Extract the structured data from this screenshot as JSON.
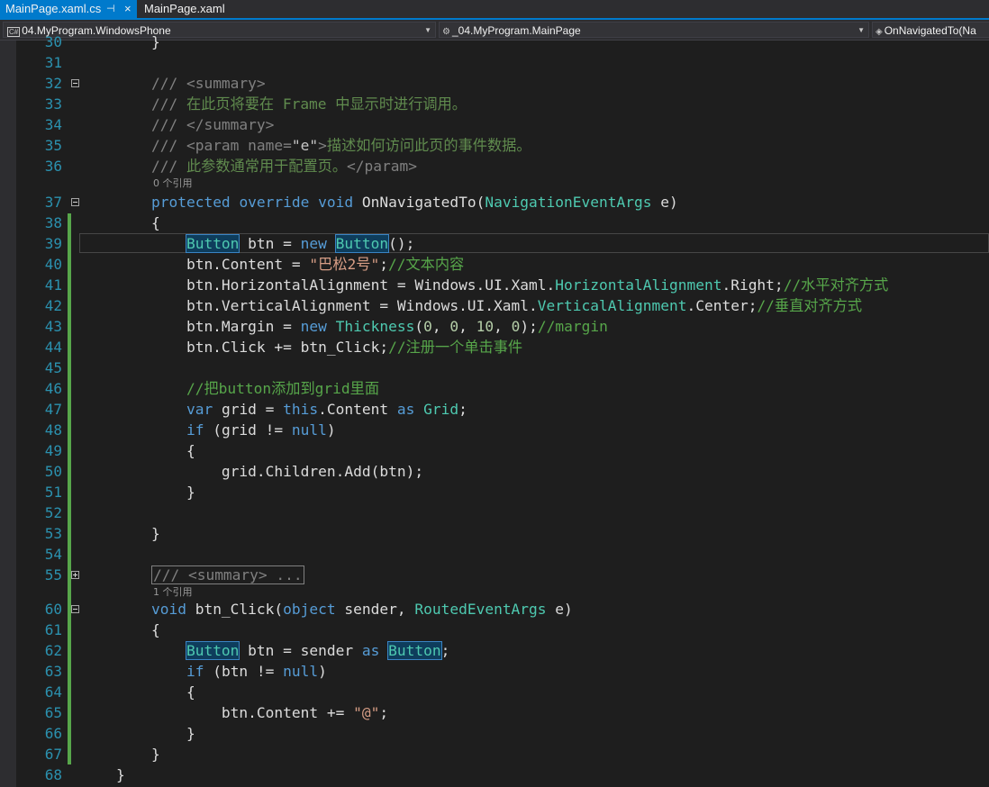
{
  "tabs": [
    {
      "label": "MainPage.xaml.cs",
      "active": true,
      "pin_glyph": "⊣",
      "close_glyph": "×"
    },
    {
      "label": "MainPage.xaml",
      "active": false
    }
  ],
  "navbar": {
    "project": "04.MyProgram.WindowsPhone",
    "class": "_04.MyProgram.MainPage",
    "member": "OnNavigatedTo(Na"
  },
  "codelens": {
    "ref0": "0 个引用",
    "ref1": "1 个引用"
  },
  "lines": [
    {
      "n": "30",
      "fold": "",
      "hl": false,
      "tokens": [
        {
          "t": "        }",
          "c": ""
        }
      ]
    },
    {
      "n": "31",
      "fold": "",
      "hl": false,
      "tokens": []
    },
    {
      "n": "32",
      "fold": "minus",
      "hl": false,
      "tokens": [
        {
          "t": "        ",
          "c": ""
        },
        {
          "t": "/// ",
          "c": "dtag"
        },
        {
          "t": "<summary>",
          "c": "dtag"
        }
      ]
    },
    {
      "n": "33",
      "fold": "",
      "hl": false,
      "tokens": [
        {
          "t": "        ",
          "c": ""
        },
        {
          "t": "/// ",
          "c": "dtag"
        },
        {
          "t": "在此页将要在 Frame 中显示时进行调用。",
          "c": "dc"
        }
      ]
    },
    {
      "n": "34",
      "fold": "",
      "hl": false,
      "tokens": [
        {
          "t": "        ",
          "c": ""
        },
        {
          "t": "/// ",
          "c": "dtag"
        },
        {
          "t": "</summary>",
          "c": "dtag"
        }
      ]
    },
    {
      "n": "35",
      "fold": "",
      "hl": false,
      "tokens": [
        {
          "t": "        ",
          "c": ""
        },
        {
          "t": "/// ",
          "c": "dtag"
        },
        {
          "t": "<param name=",
          "c": "dtag"
        },
        {
          "t": "\"e\"",
          "c": "dq"
        },
        {
          "t": ">",
          "c": "dtag"
        },
        {
          "t": "描述如何访问此页的事件数据。",
          "c": "dc"
        }
      ]
    },
    {
      "n": "36",
      "fold": "",
      "hl": false,
      "tokens": [
        {
          "t": "        ",
          "c": ""
        },
        {
          "t": "/// ",
          "c": "dtag"
        },
        {
          "t": "此参数通常用于配置页。",
          "c": "dc"
        },
        {
          "t": "</param>",
          "c": "dtag"
        }
      ]
    },
    {
      "n": "37",
      "fold": "minus",
      "hl": false,
      "tokens": [
        {
          "t": "        ",
          "c": ""
        },
        {
          "t": "protected",
          "c": "kw"
        },
        {
          "t": " ",
          "c": ""
        },
        {
          "t": "override",
          "c": "kw"
        },
        {
          "t": " ",
          "c": ""
        },
        {
          "t": "void",
          "c": "kw"
        },
        {
          "t": " OnNavigatedTo(",
          "c": ""
        },
        {
          "t": "NavigationEventArgs",
          "c": "ty"
        },
        {
          "t": " e)",
          "c": ""
        }
      ]
    },
    {
      "n": "38",
      "fold": "",
      "hl": false,
      "tokens": [
        {
          "t": "        {",
          "c": ""
        }
      ]
    },
    {
      "n": "39",
      "fold": "",
      "hl": true,
      "tokens": [
        {
          "t": "            ",
          "c": ""
        },
        {
          "t": "Button",
          "c": "ty refhl"
        },
        {
          "t": " btn = ",
          "c": ""
        },
        {
          "t": "new",
          "c": "kw"
        },
        {
          "t": " ",
          "c": ""
        },
        {
          "t": "Button",
          "c": "ty refhl"
        },
        {
          "t": "();",
          "c": ""
        }
      ]
    },
    {
      "n": "40",
      "fold": "",
      "hl": false,
      "tokens": [
        {
          "t": "            btn.Content = ",
          "c": ""
        },
        {
          "t": "\"巴松2号\"",
          "c": "st"
        },
        {
          "t": ";",
          "c": ""
        },
        {
          "t": "//文本内容",
          "c": "cm"
        }
      ]
    },
    {
      "n": "41",
      "fold": "",
      "hl": false,
      "tokens": [
        {
          "t": "            btn.HorizontalAlignment = Windows.UI.Xaml.",
          "c": ""
        },
        {
          "t": "HorizontalAlignment",
          "c": "ty"
        },
        {
          "t": ".Right;",
          "c": ""
        },
        {
          "t": "//水平对齐方式",
          "c": "cm"
        }
      ]
    },
    {
      "n": "42",
      "fold": "",
      "hl": false,
      "tokens": [
        {
          "t": "            btn.VerticalAlignment = Windows.UI.Xaml.",
          "c": ""
        },
        {
          "t": "VerticalAlignment",
          "c": "ty"
        },
        {
          "t": ".Center;",
          "c": ""
        },
        {
          "t": "//垂直对齐方式",
          "c": "cm"
        }
      ]
    },
    {
      "n": "43",
      "fold": "",
      "hl": false,
      "tokens": [
        {
          "t": "            btn.Margin = ",
          "c": ""
        },
        {
          "t": "new",
          "c": "kw"
        },
        {
          "t": " ",
          "c": ""
        },
        {
          "t": "Thickness",
          "c": "ty"
        },
        {
          "t": "(",
          "c": ""
        },
        {
          "t": "0",
          "c": "nm"
        },
        {
          "t": ", ",
          "c": ""
        },
        {
          "t": "0",
          "c": "nm"
        },
        {
          "t": ", ",
          "c": ""
        },
        {
          "t": "10",
          "c": "nm"
        },
        {
          "t": ", ",
          "c": ""
        },
        {
          "t": "0",
          "c": "nm"
        },
        {
          "t": ");",
          "c": ""
        },
        {
          "t": "//margin",
          "c": "cm"
        }
      ]
    },
    {
      "n": "44",
      "fold": "",
      "hl": false,
      "tokens": [
        {
          "t": "            btn.Click += btn_Click;",
          "c": ""
        },
        {
          "t": "//注册一个单击事件",
          "c": "cm"
        }
      ]
    },
    {
      "n": "45",
      "fold": "",
      "hl": false,
      "tokens": []
    },
    {
      "n": "46",
      "fold": "",
      "hl": false,
      "tokens": [
        {
          "t": "            ",
          "c": ""
        },
        {
          "t": "//把button添加到grid里面",
          "c": "cm"
        }
      ]
    },
    {
      "n": "47",
      "fold": "",
      "hl": false,
      "tokens": [
        {
          "t": "            ",
          "c": ""
        },
        {
          "t": "var",
          "c": "kw"
        },
        {
          "t": " grid = ",
          "c": ""
        },
        {
          "t": "this",
          "c": "kw"
        },
        {
          "t": ".Content ",
          "c": ""
        },
        {
          "t": "as",
          "c": "kw"
        },
        {
          "t": " ",
          "c": ""
        },
        {
          "t": "Grid",
          "c": "ty"
        },
        {
          "t": ";",
          "c": ""
        }
      ]
    },
    {
      "n": "48",
      "fold": "",
      "hl": false,
      "tokens": [
        {
          "t": "            ",
          "c": ""
        },
        {
          "t": "if",
          "c": "kw"
        },
        {
          "t": " (grid != ",
          "c": ""
        },
        {
          "t": "null",
          "c": "kw"
        },
        {
          "t": ")",
          "c": ""
        }
      ]
    },
    {
      "n": "49",
      "fold": "",
      "hl": false,
      "tokens": [
        {
          "t": "            {",
          "c": ""
        }
      ]
    },
    {
      "n": "50",
      "fold": "",
      "hl": false,
      "tokens": [
        {
          "t": "                grid.Children.Add(btn);",
          "c": ""
        }
      ]
    },
    {
      "n": "51",
      "fold": "",
      "hl": false,
      "tokens": [
        {
          "t": "            }",
          "c": ""
        }
      ]
    },
    {
      "n": "52",
      "fold": "",
      "hl": false,
      "tokens": []
    },
    {
      "n": "53",
      "fold": "",
      "hl": false,
      "tokens": [
        {
          "t": "        }",
          "c": ""
        }
      ]
    },
    {
      "n": "54",
      "fold": "",
      "hl": false,
      "tokens": []
    },
    {
      "n": "55",
      "fold": "plus",
      "hl": false,
      "tokens": [
        {
          "t": "        ",
          "c": ""
        },
        {
          "t": "/// <summary> ...",
          "c": "collapsed"
        }
      ]
    },
    {
      "n": "60",
      "fold": "minus",
      "hl": false,
      "tokens": [
        {
          "t": "        ",
          "c": ""
        },
        {
          "t": "void",
          "c": "kw"
        },
        {
          "t": " btn_Click(",
          "c": ""
        },
        {
          "t": "object",
          "c": "kw"
        },
        {
          "t": " sender, ",
          "c": ""
        },
        {
          "t": "RoutedEventArgs",
          "c": "ty"
        },
        {
          "t": " e)",
          "c": ""
        }
      ]
    },
    {
      "n": "61",
      "fold": "",
      "hl": false,
      "tokens": [
        {
          "t": "        {",
          "c": ""
        }
      ]
    },
    {
      "n": "62",
      "fold": "",
      "hl": false,
      "tokens": [
        {
          "t": "            ",
          "c": ""
        },
        {
          "t": "Button",
          "c": "ty refhl"
        },
        {
          "t": " btn = sender ",
          "c": ""
        },
        {
          "t": "as",
          "c": "kw"
        },
        {
          "t": " ",
          "c": ""
        },
        {
          "t": "Button",
          "c": "ty refhl"
        },
        {
          "t": ";",
          "c": ""
        }
      ]
    },
    {
      "n": "63",
      "fold": "",
      "hl": false,
      "tokens": [
        {
          "t": "            ",
          "c": ""
        },
        {
          "t": "if",
          "c": "kw"
        },
        {
          "t": " (btn != ",
          "c": ""
        },
        {
          "t": "null",
          "c": "kw"
        },
        {
          "t": ")",
          "c": ""
        }
      ]
    },
    {
      "n": "64",
      "fold": "",
      "hl": false,
      "tokens": [
        {
          "t": "            {",
          "c": ""
        }
      ]
    },
    {
      "n": "65",
      "fold": "",
      "hl": false,
      "tokens": [
        {
          "t": "                btn.Content += ",
          "c": ""
        },
        {
          "t": "\"@\"",
          "c": "st"
        },
        {
          "t": ";",
          "c": ""
        }
      ]
    },
    {
      "n": "66",
      "fold": "",
      "hl": false,
      "tokens": [
        {
          "t": "            }",
          "c": ""
        }
      ]
    },
    {
      "n": "67",
      "fold": "",
      "hl": false,
      "tokens": [
        {
          "t": "        }",
          "c": ""
        }
      ]
    },
    {
      "n": "68",
      "fold": "",
      "hl": false,
      "tokens": [
        {
          "t": "    }",
          "c": ""
        }
      ]
    }
  ],
  "colors": {
    "accent": "#007acc",
    "keyword": "#569cd6",
    "type": "#4ec9b0",
    "comment": "#57a64a",
    "string": "#d69d85",
    "line_number": "#2b91af",
    "changed_lines": "#57a64a"
  }
}
